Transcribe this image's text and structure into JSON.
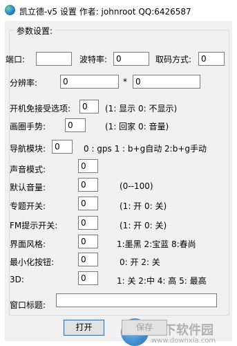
{
  "window": {
    "title": "凯立德-v5 设置  作者: johnroot  QQ:6426587"
  },
  "group": {
    "title": "参数设置:"
  },
  "fields": {
    "port": {
      "label": "端口:",
      "value": ""
    },
    "baud": {
      "label": "波特率:",
      "value": "0"
    },
    "decode": {
      "label": "取码方式:",
      "value": "0"
    },
    "resolution": {
      "label": "分辨率:",
      "width": "0",
      "separator": "*",
      "height": "0"
    },
    "boot_skip": {
      "label": "开机免接受选项:",
      "value": "0",
      "hint": "(1: 显示 0: 不显示)"
    },
    "gesture": {
      "label": "画圈手势:",
      "value": "0",
      "hint": "(1: 回家 0: 音量)"
    },
    "nav_mode": {
      "label": "导航模块:",
      "value": "0",
      "hint": "0 : gps  1 : b+g自动  2:b+g手动"
    },
    "voice_mode": {
      "label": "声音模式:",
      "value": "0"
    },
    "default_volume": {
      "label": "默认音量:",
      "value": "0",
      "hint": "(0--100)"
    },
    "topic_switch": {
      "label": "专题开关:",
      "value": "0",
      "hint": "(1: 开 0: 关)"
    },
    "fm_prompt": {
      "label": "FM提示开关:",
      "value": "0",
      "hint": "(1: 开 0: 关)"
    },
    "ui_style": {
      "label": "界面风格:",
      "value": "0",
      "hint": "1:墨黑  2:宝蓝  8:春尚"
    },
    "minimize_button": {
      "label": "最小化按钮:",
      "value": "0",
      "hint": "0: 开 2: 关"
    },
    "mode_3d": {
      "label": "3D:",
      "value": "0",
      "hint": "1: 关 2:中 4: 高 5: 最高"
    },
    "window_title": {
      "label": "窗口标题:",
      "value": ""
    }
  },
  "buttons": {
    "open": "打开",
    "save": "保存"
  },
  "watermark": {
    "text": "当下软件园",
    "url": "www.downxia.com"
  }
}
